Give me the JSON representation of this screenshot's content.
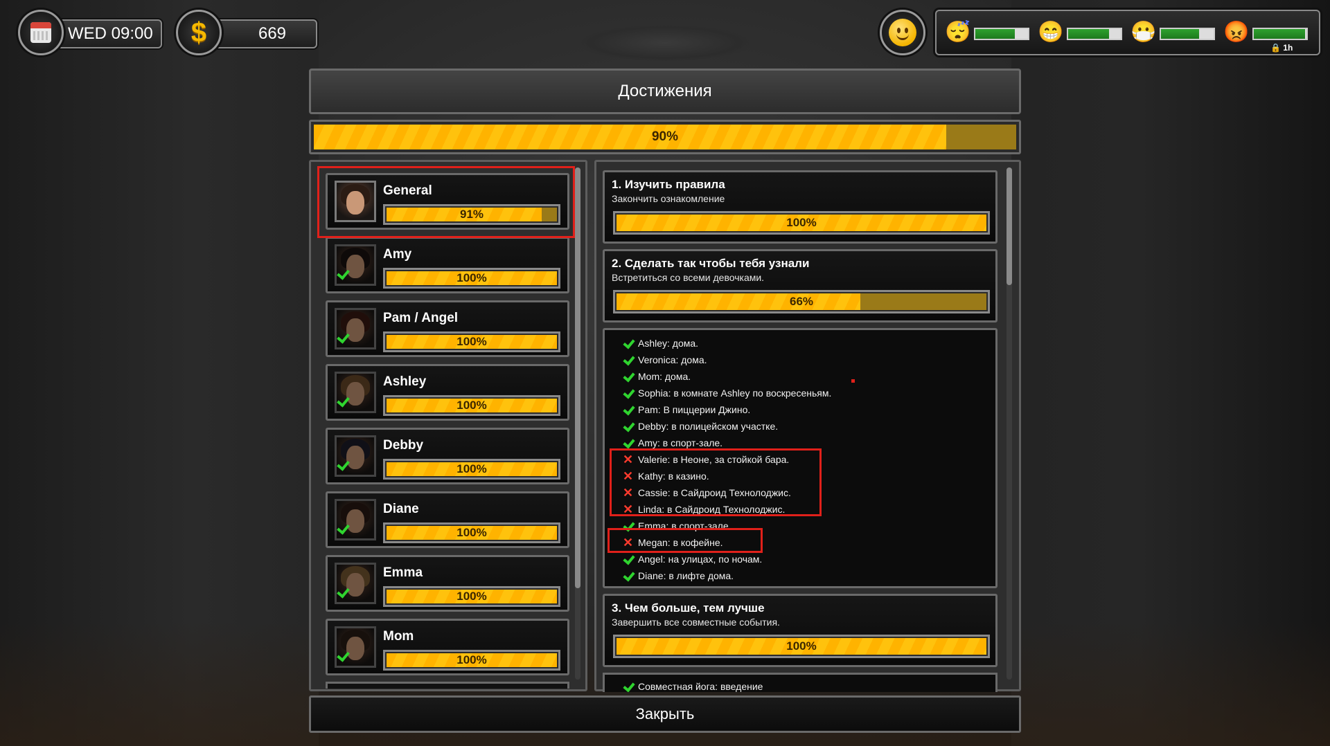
{
  "hud": {
    "datetime": "WED 09:00",
    "money": "669",
    "mood_icon": "smiley-face-icon",
    "needs": [
      {
        "icon": "sleepy-face-icon",
        "glyph": "😴",
        "level": 0.75
      },
      {
        "icon": "grinning-face-icon",
        "glyph": "😁",
        "level": 0.78
      },
      {
        "icon": "mask-face-icon",
        "glyph": "😷",
        "level": 0.72
      },
      {
        "icon": "angry-face-icon",
        "glyph": "😡",
        "level": 0.98
      }
    ],
    "timer": "🔒 1h"
  },
  "dialog": {
    "title": "Достижения",
    "total_progress": "90%",
    "total_progress_value": 0.9,
    "close_label": "Закрыть"
  },
  "characters": [
    {
      "name": "General",
      "progress": "91%",
      "value": 0.91,
      "checked": false
    },
    {
      "name": "Amy",
      "progress": "100%",
      "value": 1.0,
      "checked": true
    },
    {
      "name": "Pam / Angel",
      "progress": "100%",
      "value": 1.0,
      "checked": true
    },
    {
      "name": "Ashley",
      "progress": "100%",
      "value": 1.0,
      "checked": true
    },
    {
      "name": "Debby",
      "progress": "100%",
      "value": 1.0,
      "checked": true
    },
    {
      "name": "Diane",
      "progress": "100%",
      "value": 1.0,
      "checked": true
    },
    {
      "name": "Emma",
      "progress": "100%",
      "value": 1.0,
      "checked": true
    },
    {
      "name": "Mom",
      "progress": "100%",
      "value": 1.0,
      "checked": true
    }
  ],
  "achievements": [
    {
      "title": "1. Изучить правила",
      "desc": "Закончить ознакомление",
      "progress": "100%",
      "value": 1.0
    },
    {
      "title": "2. Сделать так чтобы тебя узнали",
      "desc": "Встретиться со всеми девочками.",
      "progress": "66%",
      "value": 0.66
    },
    {
      "title": "3. Чем больше, тем лучше",
      "desc": "Завершить все совместные события.",
      "progress": "100%",
      "value": 1.0
    }
  ],
  "requirements": [
    {
      "text": "Ashley: дома.",
      "done": true
    },
    {
      "text": "Veronica: дома.",
      "done": true
    },
    {
      "text": "Mom: дома.",
      "done": true
    },
    {
      "text": "Sophia: в комнате Ashley по воскресеньям.",
      "done": true
    },
    {
      "text": "Pam: В пиццерии Джино.",
      "done": true
    },
    {
      "text": "Debby: в полицейском участке.",
      "done": true
    },
    {
      "text": "Amy: в спорт-зале.",
      "done": true
    },
    {
      "text": "Valerie: в Неоне, за стойкой бара.",
      "done": false
    },
    {
      "text": "Kathy: в казино.",
      "done": false
    },
    {
      "text": "Cassie: в Сайдроид Технолоджис.",
      "done": false
    },
    {
      "text": "Linda: в Сайдроид Технолоджис.",
      "done": false
    },
    {
      "text": "Emma: в спорт-зале.",
      "done": true
    },
    {
      "text": "Megan: в кофейне.",
      "done": false
    },
    {
      "text": "Angel: на улицах, по ночам.",
      "done": true
    },
    {
      "text": "Diane: в лифте дома.",
      "done": true
    }
  ],
  "clipped_item": {
    "text": "Совместная йога: введение",
    "done": true
  }
}
